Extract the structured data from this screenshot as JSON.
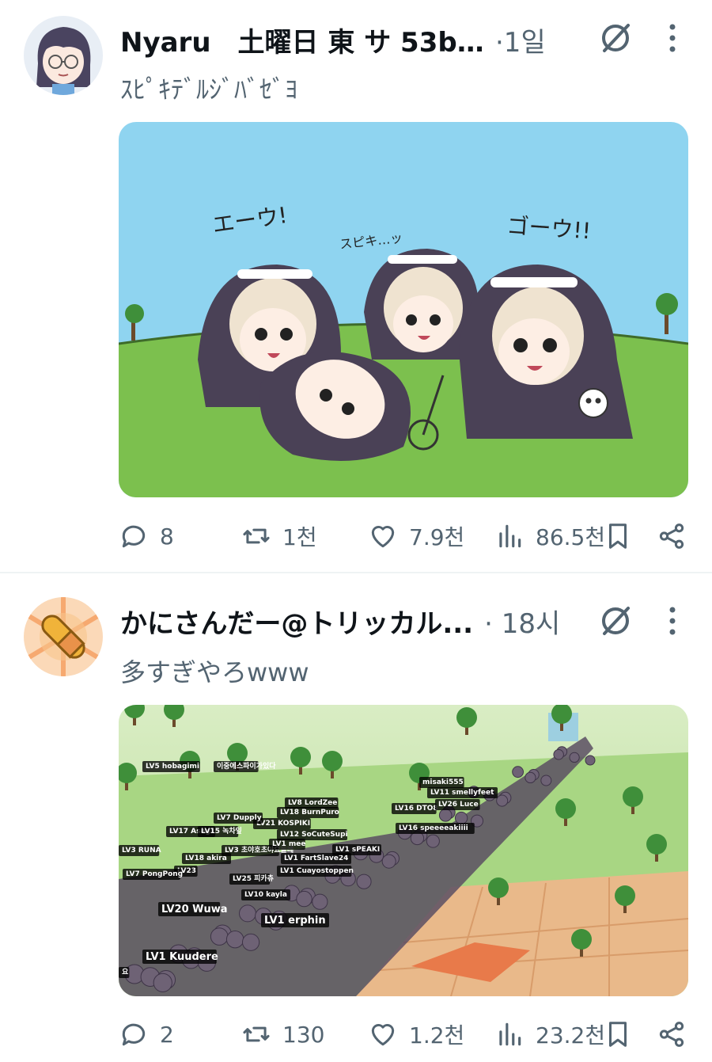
{
  "tweets": [
    {
      "author": "Nyaru　土曜日 東 サ 53b ...",
      "time": "·1일",
      "text": "ｽﾋﾟｷﾃﾞﾙｼﾞﾊﾞｾﾞﾖ",
      "image_text": {
        "left": "エーウ!",
        "middle": "スピキ…ッ",
        "right": "ゴーウ!!"
      },
      "stats": {
        "replies": "8",
        "reposts": "1천",
        "likes": "7.9천",
        "views": "86.5천"
      }
    },
    {
      "author": "かにさんだー@トリッカル...",
      "time": "· 18시",
      "text": "多すぎやろwww",
      "game_labels": [
        "LV1 Kuudere",
        "LV1 erphin",
        "LV20 Wuwa",
        "LV10 kayla",
        "LV25 피카츄",
        "LV23",
        "LV18 akira",
        "LV1 Cuayostoppen",
        "LV1 FartSlave24",
        "LV3 초야호초야요들레",
        "LV1 mee",
        "LV12 SoCuteSupi",
        "LV1 sPEAKI",
        "LV17 Asagi",
        "LV15 녹차잎",
        "LV21 KOSPIKI",
        "LV18 BurnPuro",
        "LV7 Dupply",
        "LV16 speeeeakiiii",
        "LV16 DTO8",
        "LV11 smellyfeet",
        "LV26 Luce",
        "misaki555",
        "LV7 PongPong",
        "LV3 RUNA",
        "이중에스파이가있다",
        "LV5 hobagimi",
        "LV8 LordZee",
        "요"
      ],
      "stats": {
        "replies": "2",
        "reposts": "130",
        "likes": "1.2천",
        "views": "23.2천"
      }
    }
  ],
  "colors": {
    "text_primary": "#0f1419",
    "text_secondary": "#536471",
    "divider": "#eff3f4",
    "sky": "#8fd4f0",
    "grass": "#7cc04e"
  },
  "icons": [
    "reply-icon",
    "repost-icon",
    "like-icon",
    "views-icon",
    "bookmark-icon",
    "share-icon",
    "grok-icon",
    "more-icon"
  ]
}
